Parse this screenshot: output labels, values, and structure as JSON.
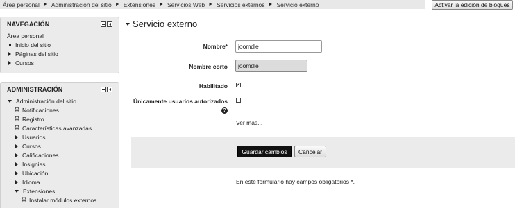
{
  "breadcrumb": {
    "items": [
      "Área personal",
      "Administración del sitio",
      "Extensiones",
      "Servicios Web",
      "Servicios externos",
      "Servicio externo"
    ],
    "separator": "►"
  },
  "header": {
    "edit_blocks_label": "Activar la edición de bloques"
  },
  "navigation_block": {
    "title": "NAVEGACIÓN",
    "items": [
      {
        "label": "Área personal",
        "marker": "none"
      },
      {
        "label": "Inicio del sitio",
        "marker": "bullet"
      },
      {
        "label": "Páginas del sitio",
        "marker": "collapsed"
      },
      {
        "label": "Cursos",
        "marker": "collapsed"
      }
    ]
  },
  "admin_block": {
    "title": "ADMINISTRACIÓN",
    "items": [
      {
        "label": "Administración del sitio",
        "marker": "expanded"
      },
      {
        "label": "Notificaciones",
        "marker": "gear"
      },
      {
        "label": "Registro",
        "marker": "gear"
      },
      {
        "label": "Características avanzadas",
        "marker": "gear"
      },
      {
        "label": "Usuarios",
        "marker": "collapsed"
      },
      {
        "label": "Cursos",
        "marker": "collapsed"
      },
      {
        "label": "Calificaciones",
        "marker": "collapsed"
      },
      {
        "label": "Insignias",
        "marker": "collapsed"
      },
      {
        "label": "Ubicación",
        "marker": "collapsed"
      },
      {
        "label": "Idioma",
        "marker": "collapsed"
      },
      {
        "label": "Extensiones",
        "marker": "expanded"
      },
      {
        "label": "Instalar módulos externos",
        "marker": "gear"
      }
    ]
  },
  "form": {
    "heading": "Servicio externo",
    "name_label": "Nombre*",
    "name_value": "joomdle",
    "shortname_label": "Nombre corto",
    "shortname_value": "joomdle",
    "enabled_label": "Habilitado",
    "enabled_checked": true,
    "authorized_only_label": "Únicamente usuarios autorizados",
    "authorized_only_checked": false,
    "help_icon_glyph": "?",
    "show_more_link": "Ver más...",
    "save_label": "Guardar cambios",
    "cancel_label": "Cancelar",
    "required_note": "En este formulario hay campos obligatorios *."
  },
  "icons": {
    "breadcrumb_separator": "triangle-right-icon",
    "gear": "gear-icon",
    "help": "help-icon",
    "collapse": "collapse-block-icon",
    "dock": "dock-block-icon"
  },
  "colors": {
    "page_bg": "#ffffff",
    "block_bg": "#ebebeb",
    "primary_button_bg": "#111111",
    "readonly_field_bg": "#dcdcdc"
  }
}
